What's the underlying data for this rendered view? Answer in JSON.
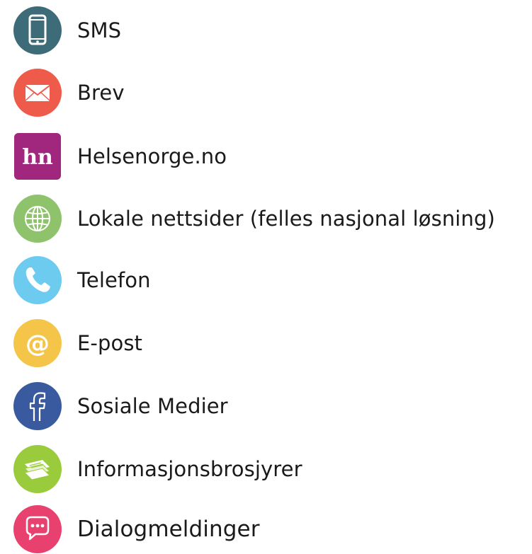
{
  "channels": [
    {
      "label": "SMS",
      "icon": "mobile-phone-icon",
      "color": "#3e6b78"
    },
    {
      "label": "Brev",
      "icon": "envelope-icon",
      "color": "#ef5b4b"
    },
    {
      "label": "Helsenorge.no",
      "icon": "helsenorge-logo-icon",
      "icon_text": "hn",
      "color": "#a0267e"
    },
    {
      "label": "Lokale nettsider (felles nasjonal løsning)",
      "icon": "globe-icon",
      "color": "#8ec26b"
    },
    {
      "label": "Telefon",
      "icon": "telephone-icon",
      "color": "#6dcbf0"
    },
    {
      "label": "E-post",
      "icon": "at-sign-icon",
      "icon_text": "@",
      "color": "#f5c54a"
    },
    {
      "label": "Sosiale Medier",
      "icon": "facebook-icon",
      "icon_text": "f",
      "color": "#3a5aa0"
    },
    {
      "label": "Informasjonsbrosjyrer",
      "icon": "brochures-icon",
      "color": "#9acb3c"
    },
    {
      "label": "Dialogmeldinger",
      "icon": "chat-bubble-icon",
      "color": "#e8416f"
    }
  ]
}
